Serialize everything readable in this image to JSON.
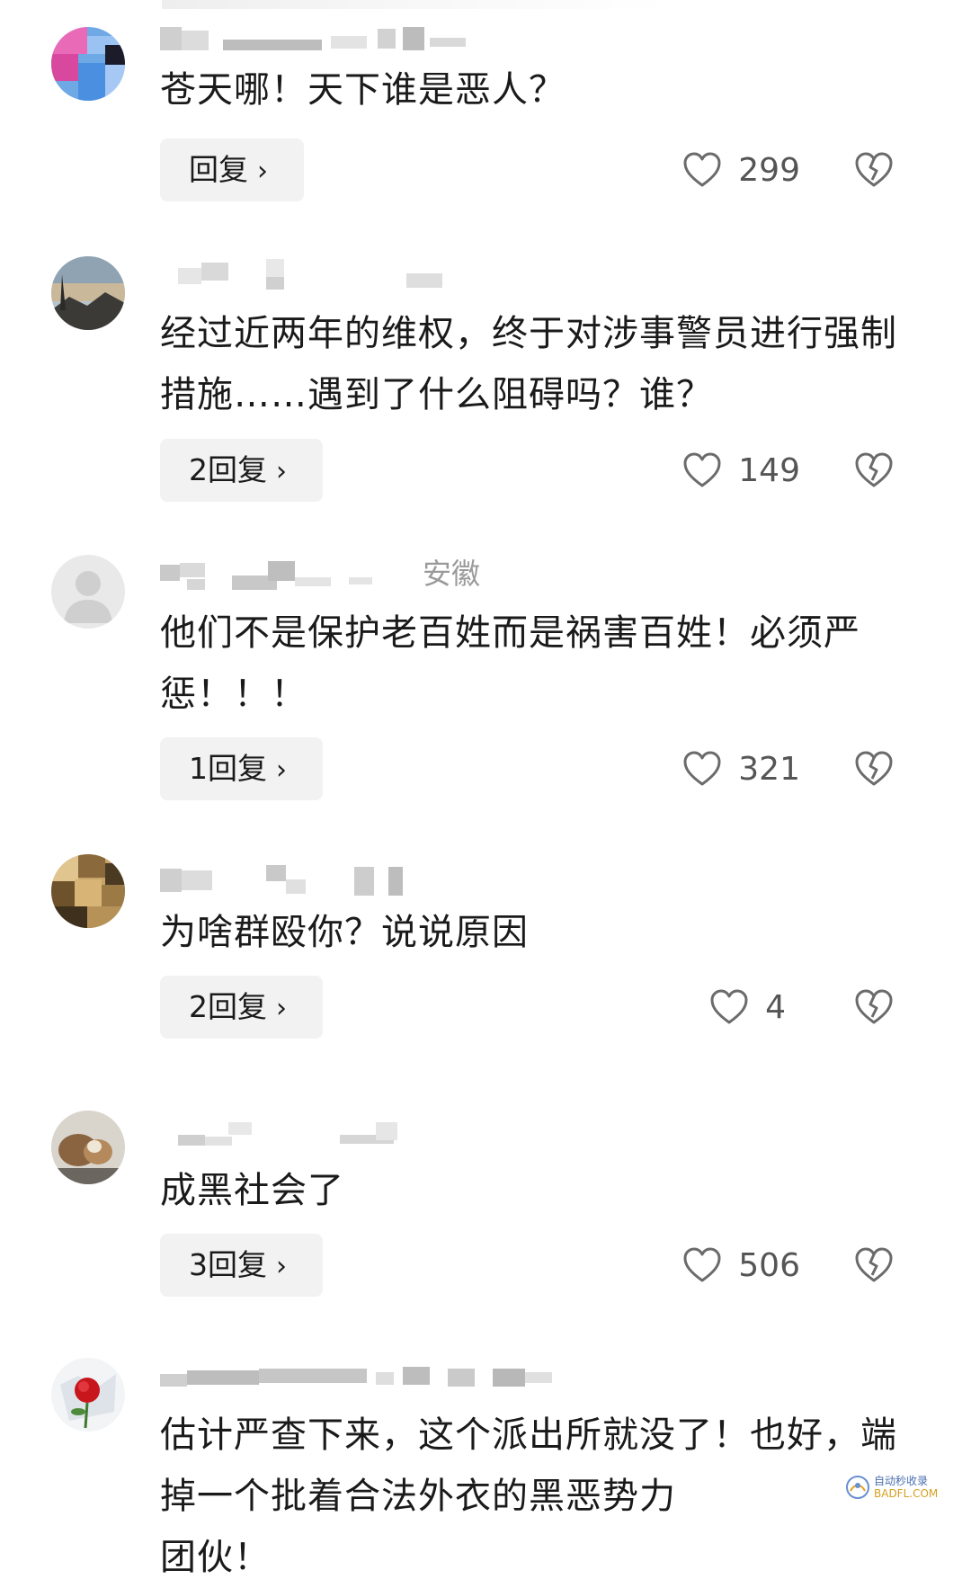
{
  "comments": [
    {
      "text": "苍天哪！天下谁是恶人？",
      "reply_label": "回复",
      "likes": "299"
    },
    {
      "text": "经过近两年的维权，终于对涉事警员进行强制措施……遇到了什么阻碍吗？谁？",
      "reply_label": "2回复",
      "likes": "149"
    },
    {
      "meta_location": "安徽",
      "text": "他们不是保护老百姓而是祸害百姓！必须严惩！！！",
      "reply_label": "1回复",
      "likes": "321"
    },
    {
      "text": "为啥群殴你？说说原因",
      "reply_label": "2回复",
      "likes": "4"
    },
    {
      "text": "成黑社会了",
      "reply_label": "3回复",
      "likes": "506"
    },
    {
      "text": "估计严查下来，这个派出所就没了！也好，端掉一个批着合法外衣的黑恶势力",
      "text_cut": "团伙！"
    }
  ],
  "icons": {
    "like": "heart-outline-icon",
    "dislike": "broken-heart-icon",
    "reply_chevron": "chevron-right-icon"
  },
  "watermark": {
    "line1": "自动秒收录",
    "line2": "BADFL.COM"
  },
  "colors": {
    "text": "#1a1a1a",
    "count": "#555555",
    "reply_bg": "#f2f2f2",
    "icon": "#6b6b6b"
  }
}
